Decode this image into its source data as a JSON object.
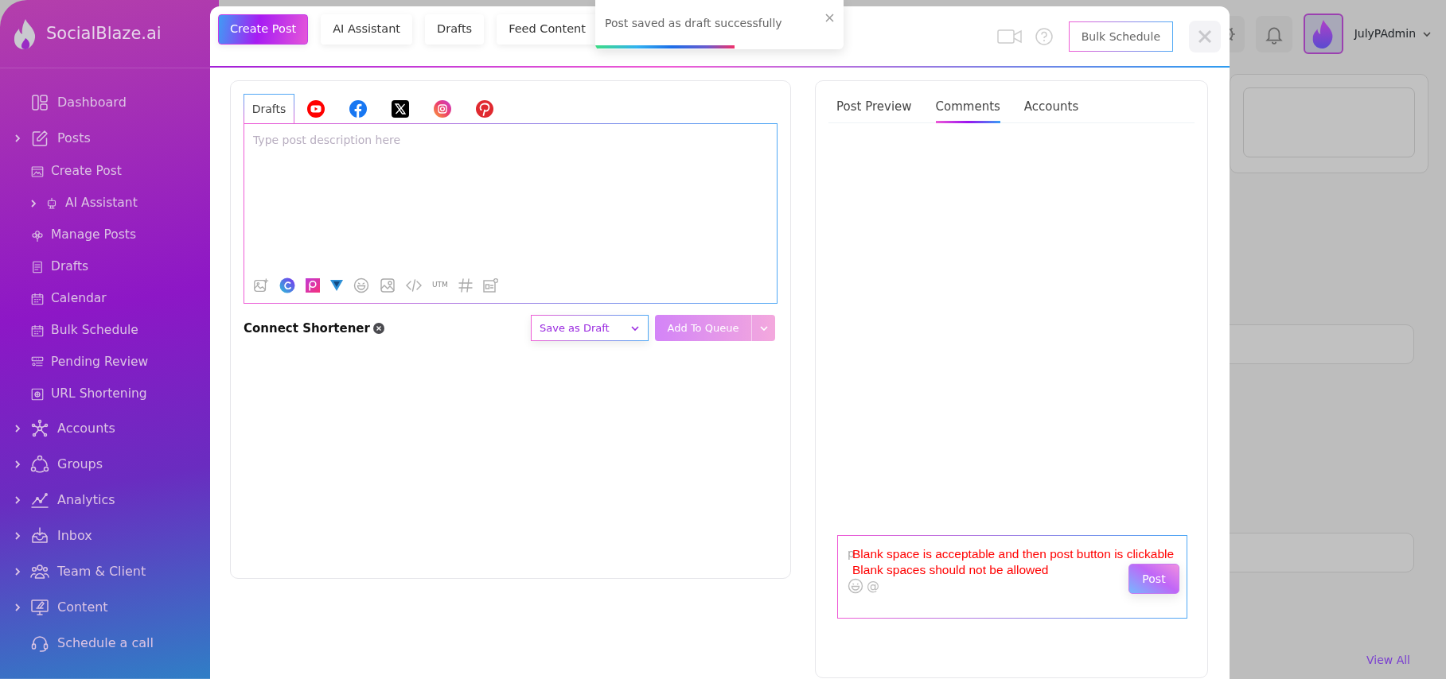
{
  "sidebar": {
    "brand": "SocialBlaze.ai",
    "items": [
      {
        "label": "Dashboard",
        "has_submenu": false
      },
      {
        "label": "Posts",
        "has_submenu": true,
        "children": [
          {
            "label": "Create Post",
            "has_submenu": false
          },
          {
            "label": "AI Assistant",
            "has_submenu": true
          },
          {
            "label": "Manage Posts",
            "has_submenu": false
          },
          {
            "label": "Drafts",
            "has_submenu": false
          },
          {
            "label": "Calendar",
            "has_submenu": false
          },
          {
            "label": "Bulk Schedule",
            "has_submenu": false
          },
          {
            "label": "Pending Review",
            "has_submenu": false
          },
          {
            "label": "URL Shortening",
            "has_submenu": false
          }
        ]
      },
      {
        "label": "Accounts",
        "has_submenu": true
      },
      {
        "label": "Groups",
        "has_submenu": true
      },
      {
        "label": "Analytics",
        "has_submenu": true
      },
      {
        "label": "Inbox",
        "has_submenu": true
      },
      {
        "label": "Team & Client",
        "has_submenu": true
      },
      {
        "label": "Content",
        "has_submenu": true
      },
      {
        "label": "Schedule a call",
        "has_submenu": false
      }
    ]
  },
  "topbar": {
    "user": "JulyPAdmin"
  },
  "background": {
    "link": "View All"
  },
  "modal": {
    "tabs": [
      {
        "label": "Create Post",
        "selected": true
      },
      {
        "label": "AI Assistant",
        "selected": false
      },
      {
        "label": "Drafts",
        "selected": false
      },
      {
        "label": "Feed Content",
        "selected": false
      }
    ],
    "bulk_button": "Bulk Schedule"
  },
  "toast": {
    "message": "Post saved as draft successfully",
    "level": 0.56
  },
  "composer": {
    "channel_tabs": [
      {
        "kind": "text",
        "label": "Drafts",
        "selected": true
      },
      {
        "kind": "youtube",
        "selected": false
      },
      {
        "kind": "facebook",
        "selected": false
      },
      {
        "kind": "x",
        "selected": false
      },
      {
        "kind": "instagram",
        "selected": false
      },
      {
        "kind": "pinterest",
        "selected": false
      }
    ],
    "placeholder": "Type post description here",
    "utm": "UTM",
    "shortener": "Connect Shortener",
    "save_button": "Save as Draft",
    "queue_button": "Add To Queue",
    "queue_disabled": true
  },
  "preview": {
    "tabs": [
      {
        "label": "Post Preview",
        "selected": false
      },
      {
        "label": "Comments",
        "selected": true
      },
      {
        "label": "Accounts",
        "selected": false
      }
    ],
    "comment": {
      "placeholder": "p",
      "mention": "@",
      "button": "Post"
    },
    "annotation": [
      "Blank space is acceptable and then post button is clickable",
      "Blank spaces should not be allowed"
    ]
  }
}
